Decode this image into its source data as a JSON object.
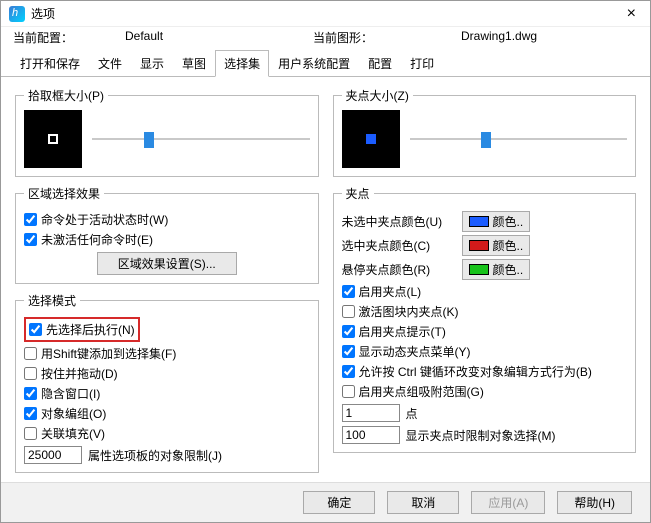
{
  "titlebar": {
    "title": "选项"
  },
  "config": {
    "currentConfigLabel": "当前配置：",
    "currentConfigValue": "Default",
    "currentDrawingLabel": "当前图形：",
    "currentDrawingValue": "Drawing1.dwg"
  },
  "tabs": {
    "openSave": "打开和保存",
    "files": "文件",
    "display": "显示",
    "draft": "草图",
    "selection": "选择集",
    "userPref": "用户系统配置",
    "profiles": "配置",
    "print": "打印"
  },
  "left": {
    "pickbox": {
      "legend": "拾取框大小(P)"
    },
    "regionSel": {
      "legend": "区域选择效果",
      "cmdActive": "命令处于活动状态时(W)",
      "noCmdActive": "未激活任何命令时(E)",
      "effectBtn": "区域效果设置(S)..."
    },
    "selMode": {
      "legend": "选择模式",
      "preselect": "先选择后执行(N)",
      "shiftAdd": "用Shift键添加到选择集(F)",
      "pressDrag": "按住并拖动(D)",
      "impliedWindow": "隐含窗口(I)",
      "objectGroup": "对象编组(O)",
      "assocHatch": "关联填充(V)",
      "paletteLimit": "25000",
      "paletteLimitLabel": "属性选项板的对象限制(J)"
    }
  },
  "right": {
    "gripsize": {
      "legend": "夹点大小(Z)"
    },
    "grips": {
      "legend": "夹点",
      "unselColor": "未选中夹点颜色(U)",
      "selColor": "选中夹点颜色(C)",
      "hoverColor": "悬停夹点颜色(R)",
      "colorBtn": "颜色..",
      "enableGrips": "启用夹点(L)",
      "enableBlockGrips": "激活图块内夹点(K)",
      "enableGripTips": "启用夹点提示(T)",
      "showDynMenu": "显示动态夹点菜单(Y)",
      "allowCtrlCycle": "允许按 Ctrl 键循环改变对象编辑方式行为(B)",
      "enableGroupGrips": "启用夹点组吸附范围(G)",
      "pointInput": "1",
      "pointLabel": "点",
      "showLimit": "100",
      "showLimitLabel": "显示夹点时限制对象选择(M)"
    },
    "colors": {
      "unsel": "#1b5cff",
      "sel": "#d21a1a",
      "hover": "#17c21a"
    }
  },
  "footer": {
    "ok": "确定",
    "cancel": "取消",
    "apply": "应用(A)",
    "help": "帮助(H)"
  }
}
